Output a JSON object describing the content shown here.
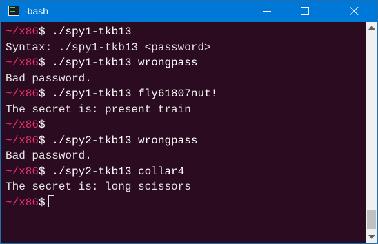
{
  "window": {
    "title": "-bash",
    "controls": {
      "minimize": "minimize",
      "maximize": "maximize",
      "close": "close"
    },
    "colors": {
      "titlebar": "#0078d7",
      "terminal_bg": "#2b0b1f",
      "prompt": "#e8316a"
    }
  },
  "terminal": {
    "lines": [
      {
        "type": "prompt",
        "path": "~/x86",
        "symbol": "$",
        "command": " ./spy1-tkb13"
      },
      {
        "type": "output",
        "text": "Syntax: ./spy1-tkb13 <password>"
      },
      {
        "type": "prompt",
        "path": "~/x86",
        "symbol": "$",
        "command": " ./spy1-tkb13 wrongpass"
      },
      {
        "type": "output",
        "text": "Bad password."
      },
      {
        "type": "prompt",
        "path": "~/x86",
        "symbol": "$",
        "command": " ./spy1-tkb13 fly61807nut!"
      },
      {
        "type": "output",
        "text": "The secret is: present train"
      },
      {
        "type": "prompt",
        "path": "~/x86",
        "symbol": "$",
        "command": ""
      },
      {
        "type": "prompt",
        "path": "~/x86",
        "symbol": "$",
        "command": " ./spy2-tkb13 wrongpass"
      },
      {
        "type": "output",
        "text": "Bad password."
      },
      {
        "type": "prompt",
        "path": "~/x86",
        "symbol": "$",
        "command": " ./spy2-tkb13 collar4"
      },
      {
        "type": "output",
        "text": "The secret is: long scissors"
      },
      {
        "type": "prompt",
        "path": "~/x86",
        "symbol": "$",
        "command": "",
        "cursor": true
      }
    ]
  },
  "scrollbar": {
    "up_icon": "chevron-up-icon",
    "down_icon": "chevron-down-icon"
  }
}
